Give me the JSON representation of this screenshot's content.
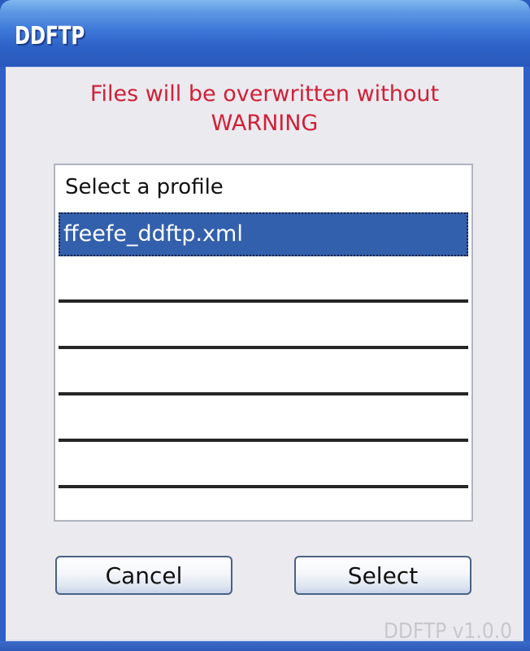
{
  "window": {
    "title": "DDFTP"
  },
  "dialog": {
    "warning_line1": "Files will be overwritten without",
    "warning_line2": "WARNING",
    "list": {
      "header": "Select a profile",
      "items": [
        {
          "label": "ffeefe_ddftp.xml",
          "selected": true
        }
      ],
      "empty_rows": 5
    },
    "buttons": {
      "cancel_label": "Cancel",
      "select_label": "Select"
    },
    "version": "DDFTP v1.0.0"
  },
  "colors": {
    "warning": "#d02038",
    "selection": "#3360ac",
    "titlebar": "#2e62c6"
  }
}
